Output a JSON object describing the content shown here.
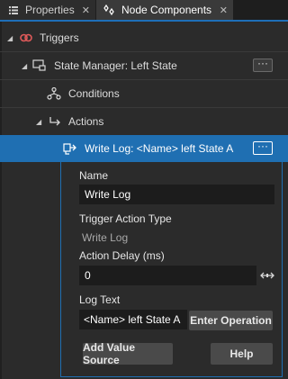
{
  "tabs": {
    "properties": "Properties",
    "node_components": "Node Components",
    "close_glyph": "✕"
  },
  "tree": {
    "triggers": "Triggers",
    "state_manager": "State Manager: Left State",
    "conditions": "Conditions",
    "actions": "Actions",
    "write_log_item": "Write Log: <Name> left State A",
    "more_glyph": "···"
  },
  "form": {
    "name_label": "Name",
    "name_value": "Write Log",
    "type_label": "Trigger Action Type",
    "type_value": "Write Log",
    "delay_label": "Action Delay (ms)",
    "delay_value": "0",
    "log_label": "Log Text",
    "log_value": "<Name> left State A",
    "enter_operation": "Enter Operation",
    "add_value_source": "Add Value Source",
    "help": "Help"
  },
  "colors": {
    "accent": "#1f6fb2",
    "trigger_icon": "#e05a5a"
  }
}
